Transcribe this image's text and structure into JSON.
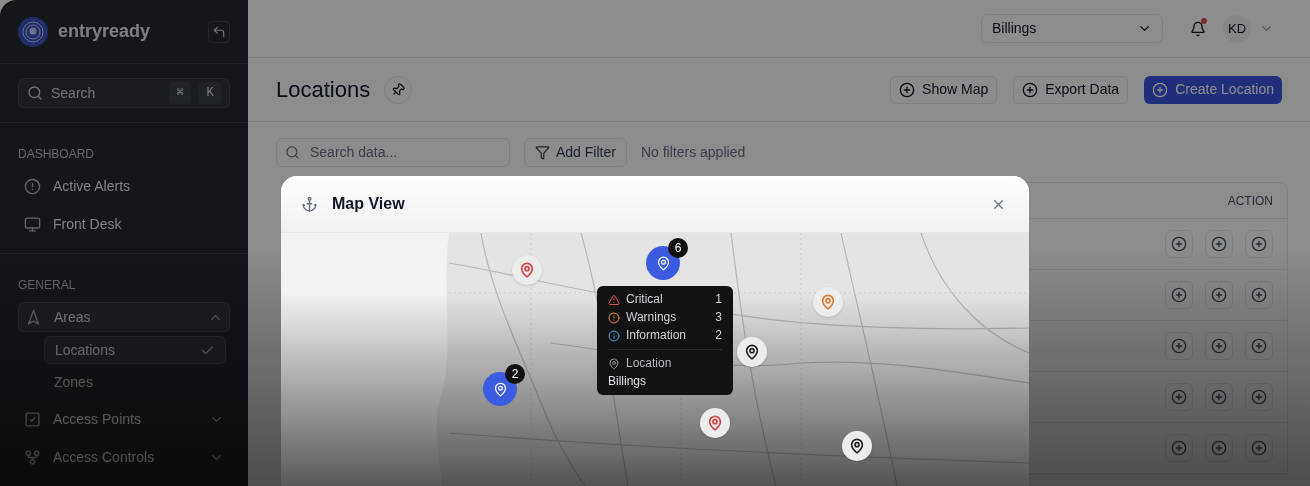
{
  "brand": {
    "name": "entryready"
  },
  "sidebar": {
    "search": {
      "placeholder": "Search",
      "shortcut": [
        "⌘",
        "K"
      ]
    },
    "sections": [
      {
        "title": "DASHBOARD",
        "items": [
          {
            "label": "Active Alerts",
            "selected": false
          },
          {
            "label": "Front Desk",
            "selected": false
          }
        ]
      },
      {
        "title": "GENERAL",
        "items": [
          {
            "label": "Areas",
            "selected": false,
            "expanded": true,
            "children": [
              {
                "label": "Locations",
                "selected": true
              },
              {
                "label": "Zones",
                "selected": false
              }
            ]
          },
          {
            "label": "Access Points",
            "selected": false,
            "expanded": false
          },
          {
            "label": "Access Controls",
            "selected": false,
            "expanded": false
          }
        ]
      }
    ]
  },
  "topbar": {
    "location_select": {
      "value": "Billings"
    },
    "notifications": {
      "unread": true
    },
    "user": {
      "initials": "KD"
    }
  },
  "page": {
    "title": "Locations",
    "actions": [
      {
        "label": "Show Map",
        "kind": "secondary"
      },
      {
        "label": "Export Data",
        "kind": "secondary"
      },
      {
        "label": "Create Location",
        "kind": "primary"
      }
    ],
    "filter": {
      "placeholder": "Search data...",
      "button": "Add Filter",
      "status": "No filters applied"
    }
  },
  "table": {
    "columns": [
      {
        "label": "ACTION"
      }
    ],
    "rows": [
      {
        "actions": [
          {
            "kind": "add"
          },
          {
            "kind": "add"
          },
          {
            "kind": "add"
          }
        ]
      },
      {
        "actions": [
          {
            "kind": "add"
          },
          {
            "kind": "add"
          },
          {
            "kind": "add"
          }
        ]
      },
      {
        "actions": [
          {
            "kind": "add"
          },
          {
            "kind": "add"
          },
          {
            "kind": "add"
          }
        ]
      },
      {
        "actions": [
          {
            "kind": "add"
          },
          {
            "kind": "add"
          },
          {
            "kind": "add"
          }
        ]
      },
      {
        "actions": [
          {
            "kind": "add"
          },
          {
            "kind": "add"
          },
          {
            "kind": "add"
          }
        ]
      }
    ]
  },
  "modal": {
    "title": "Map View",
    "pins": [
      {
        "kind": "marker",
        "color": "#d64545"
      },
      {
        "kind": "cluster",
        "count": "6",
        "color": "#3b5ce0"
      },
      {
        "kind": "marker",
        "color": "#e07a2e"
      },
      {
        "kind": "marker",
        "color": "#222222"
      },
      {
        "kind": "cluster",
        "count": "2",
        "color": "#3b5ce0"
      },
      {
        "kind": "marker",
        "color": "#d64545"
      },
      {
        "kind": "marker",
        "color": "#222222"
      }
    ],
    "tooltip": {
      "rows": [
        {
          "kind": "critical",
          "label": "Critical",
          "count": "1"
        },
        {
          "kind": "warning",
          "label": "Warnings",
          "count": "3"
        },
        {
          "kind": "info",
          "label": "Information",
          "count": "2"
        }
      ],
      "location_label": "Location",
      "location_value": "Billings"
    }
  }
}
